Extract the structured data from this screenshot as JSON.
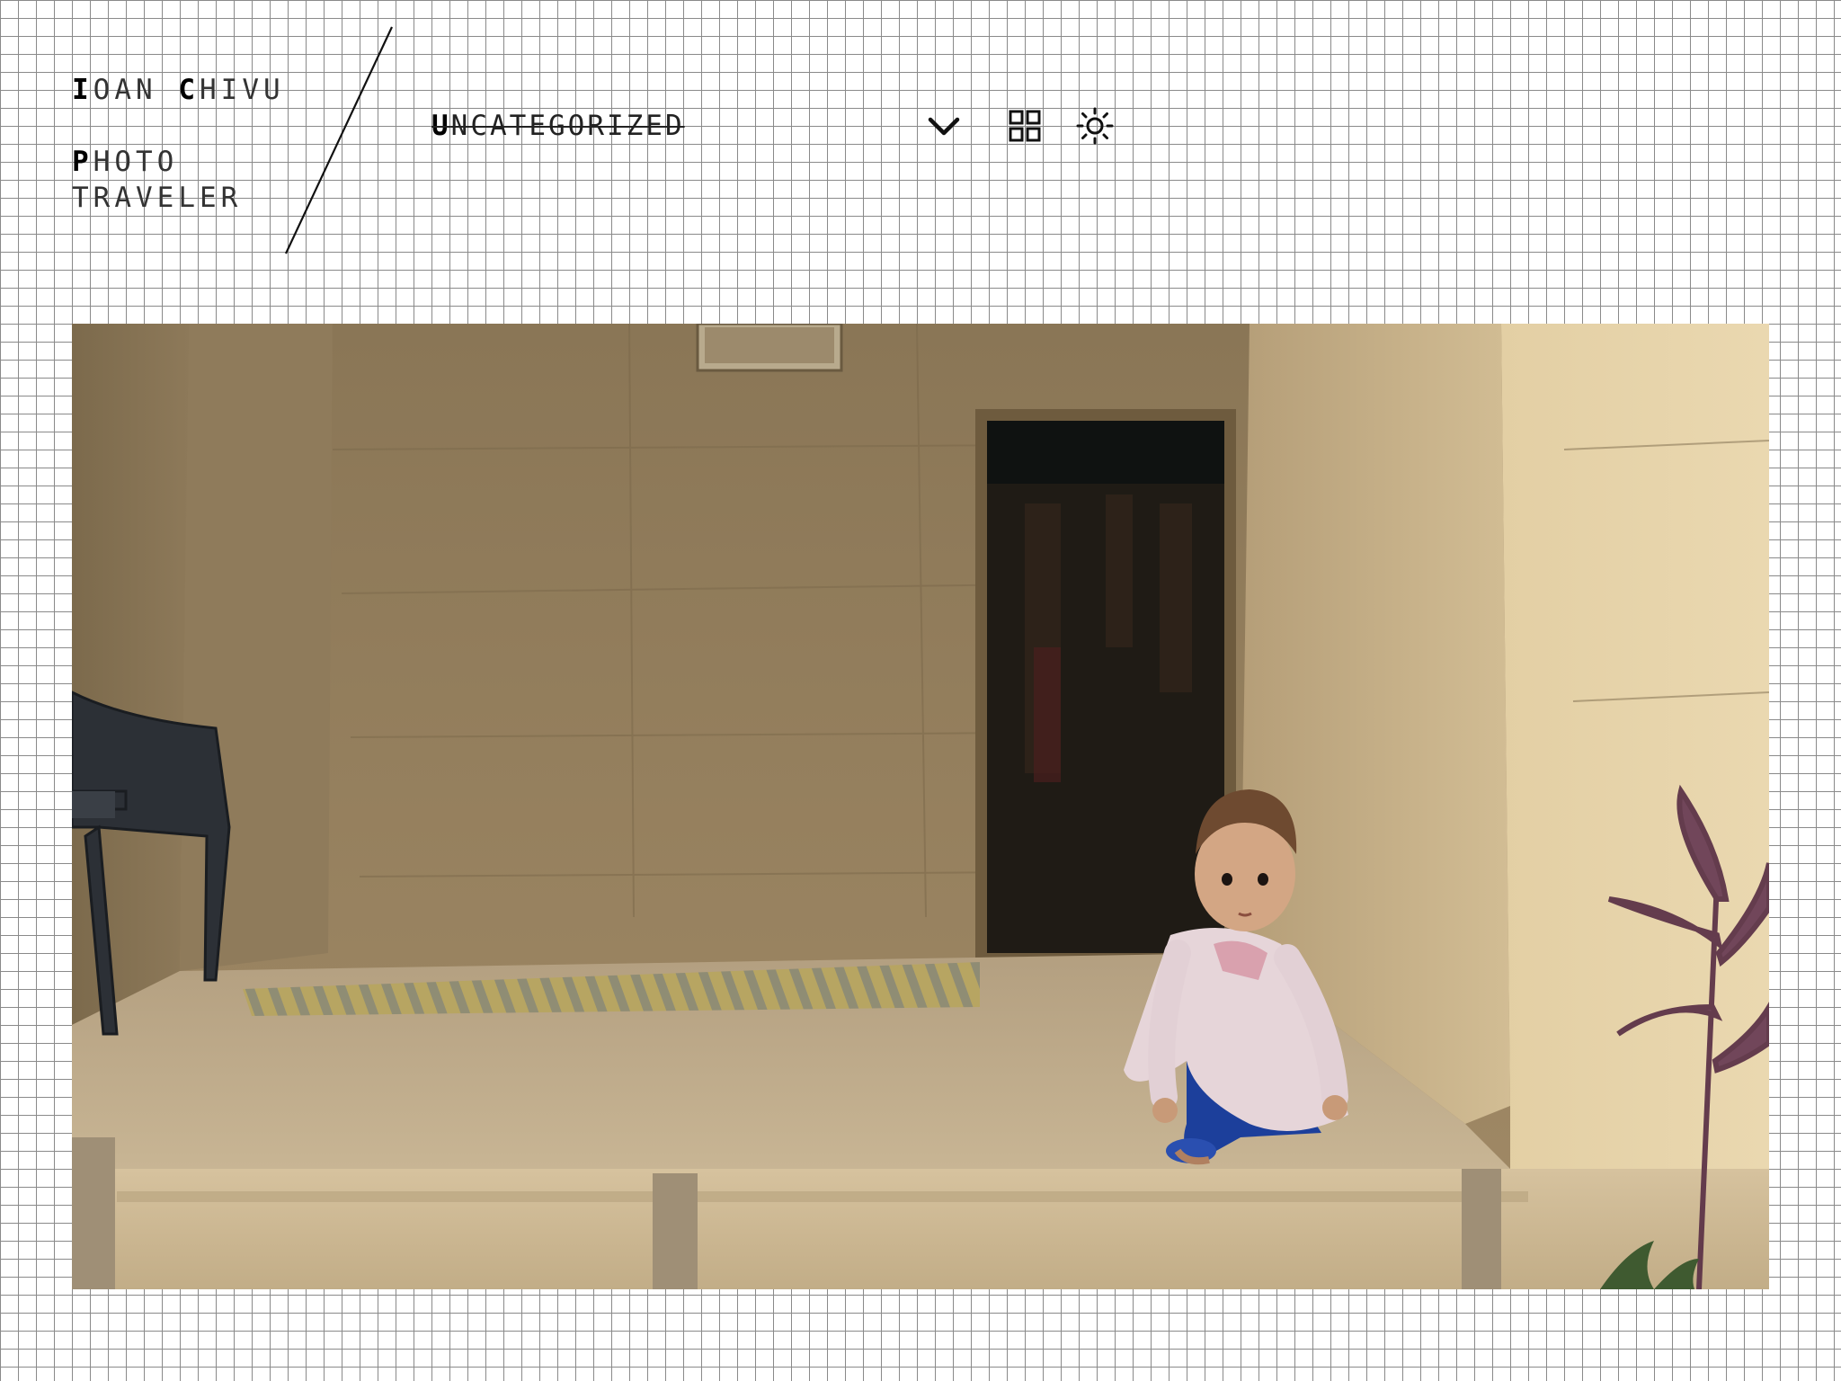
{
  "site": {
    "title_cap1": "I",
    "title_rest1": "OAN ",
    "title_cap2": "C",
    "title_rest2": "HIVU",
    "tagline_cap": "P",
    "tagline_rest": "HOTO",
    "tagline_line2": "TRAVELER"
  },
  "nav": {
    "category_cap": "U",
    "category_rest": "NCATEGORIZED"
  },
  "icons": {
    "dropdown": "chevron-down-icon",
    "grid": "grid-icon",
    "theme": "sun-icon"
  },
  "colors": {
    "grid_line": "#8a8a8a",
    "background": "#ffffff",
    "text": "#111111"
  }
}
